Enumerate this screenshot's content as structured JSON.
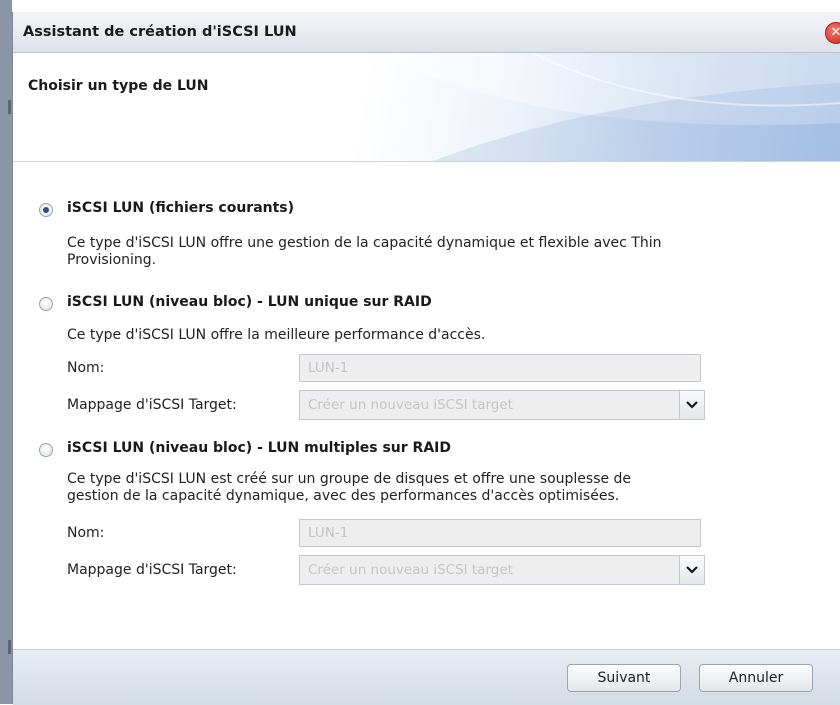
{
  "window": {
    "title": "Assistant de création d'iSCSI LUN",
    "close_glyph": "✕"
  },
  "header": {
    "title": "Choisir un type de LUN"
  },
  "options": [
    {
      "label": "iSCSI LUN (fichiers courants)",
      "checked": true,
      "description_lines": [
        "Ce type d'iSCSI LUN offre une gestion de la capacité dynamique et flexible avec Thin",
        "Provisioning."
      ]
    },
    {
      "label": "iSCSI LUN (niveau bloc) - LUN unique sur RAID",
      "checked": false,
      "description_lines": [
        "Ce type d'iSCSI LUN offre la meilleure performance d'accès."
      ],
      "name_label": "Nom:",
      "name_value": "LUN-1",
      "mapping_label": "Mappage d'iSCSI Target:",
      "mapping_value": "Créer un nouveau iSCSI target"
    },
    {
      "label": "iSCSI LUN (niveau bloc) - LUN multiples sur RAID",
      "checked": false,
      "description_lines": [
        "Ce type d'iSCSI LUN est créé sur un groupe de disques et offre une souplesse de",
        "gestion de la capacité dynamique, avec des performances d'accès optimisées."
      ],
      "name_label": "Nom:",
      "name_value": "LUN-1",
      "mapping_label": "Mappage d'iSCSI Target:",
      "mapping_value": "Créer un nouveau iSCSI target"
    }
  ],
  "footer": {
    "next_label": "Suivant",
    "cancel_label": "Annuler"
  },
  "icons": {
    "close": "close-icon",
    "dropdown": "chevron-down-icon"
  },
  "colors": {
    "close_button": "#c8281c",
    "radio_checked": "#2a4f86",
    "header_gradient_end": "#a9c3e6"
  }
}
